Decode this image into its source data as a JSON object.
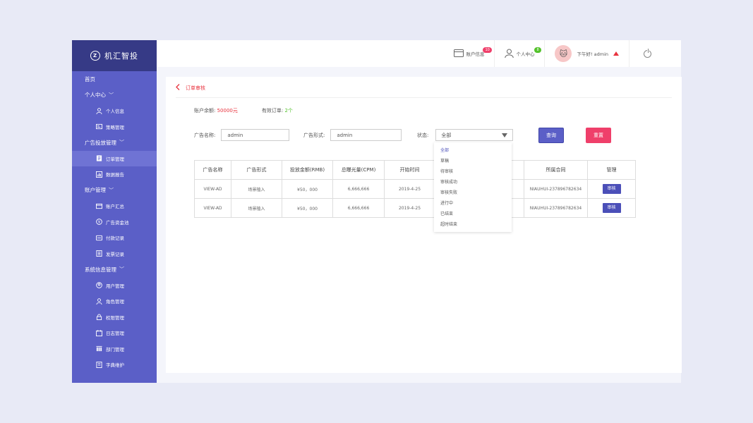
{
  "brand": {
    "name": "机汇智投",
    "mark": "Z"
  },
  "sidebar": {
    "sections": [
      {
        "label": "首页",
        "items": []
      },
      {
        "label": "个人中心",
        "items": [
          {
            "label": "个人信息",
            "icon": "user-icon"
          },
          {
            "label": "策略管理",
            "icon": "strategy-icon"
          }
        ]
      },
      {
        "label": "广告投放管理",
        "items": [
          {
            "label": "订单管理",
            "icon": "order-icon",
            "active": true
          },
          {
            "label": "数据报告",
            "icon": "report-icon"
          }
        ]
      },
      {
        "label": "账户管理",
        "items": [
          {
            "label": "账户汇总",
            "icon": "wallet-icon"
          },
          {
            "label": "广告资金池",
            "icon": "yen-icon"
          },
          {
            "label": "付款记录",
            "icon": "payment-icon"
          },
          {
            "label": "发票记录",
            "icon": "invoice-icon"
          }
        ]
      },
      {
        "label": "系统信息管理",
        "items": [
          {
            "label": "用户管理",
            "icon": "user-circle-icon"
          },
          {
            "label": "角色管理",
            "icon": "role-icon"
          },
          {
            "label": "权限管理",
            "icon": "permission-icon"
          },
          {
            "label": "日志管理",
            "icon": "log-icon"
          },
          {
            "label": "部门管理",
            "icon": "department-icon"
          },
          {
            "label": "字典维护",
            "icon": "dictionary-icon"
          }
        ]
      }
    ]
  },
  "topbar": {
    "account_info": "账户信息",
    "account_badge": "10",
    "personal_center": "个人中心",
    "personal_badge": "8",
    "greeting": "下午好! admin"
  },
  "breadcrumb": {
    "title": "订单审核"
  },
  "stats": {
    "balance_label": "账户余额:",
    "balance_value": "50000元",
    "valid_orders_label": "有效订单:",
    "valid_orders_value": "2个"
  },
  "filters": {
    "name_label": "广告名称:",
    "name_value": "admin",
    "form_label": "广告形式:",
    "form_value": "admin",
    "status_label": "状态:",
    "status_value": "全部",
    "query_label": "查询",
    "reset_label": "重置"
  },
  "status_options": [
    "全部",
    "草稿",
    "待审核",
    "审核成功",
    "审核失败",
    "进行中",
    "已结束",
    "超时结束"
  ],
  "table": {
    "headers": [
      "广告名称",
      "广告形式",
      "投放金额(RMB)",
      "总曝光量(CPM)",
      "开始时间",
      "",
      "所属合同",
      "管理"
    ],
    "rows": [
      {
        "name": "VIEW-AD",
        "form": "场景植入",
        "amount": "¥50，000",
        "cpm": "6,666,666",
        "start": "2019-4-25",
        "contract": "NIAUHUI-237896782634",
        "action": "审核"
      },
      {
        "name": "VIEW-AD",
        "form": "场景植入",
        "amount": "¥50，000",
        "cpm": "6,666,666",
        "start": "2019-4-25",
        "contract": "NIAUHUI-237896782634",
        "action": "审核"
      }
    ]
  }
}
